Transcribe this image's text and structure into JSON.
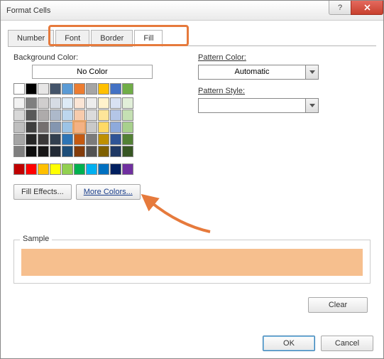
{
  "window": {
    "title": "Format Cells"
  },
  "tabs": {
    "items": [
      "Number",
      "Font",
      "Border",
      "Fill"
    ],
    "active": 3
  },
  "left": {
    "bg_label": "Background Color:",
    "no_color": "No Color",
    "fill_effects": "Fill Effects...",
    "more_colors": "More Colors...",
    "palette_theme": [
      [
        "#ffffff",
        "#000000",
        "#e7e6e6",
        "#44546a",
        "#5b9bd5",
        "#ed7d31",
        "#a5a5a5",
        "#ffc000",
        "#4472c4",
        "#70ad47"
      ],
      [
        "#f2f2f2",
        "#7f7f7f",
        "#d0cece",
        "#d6dce4",
        "#deebf6",
        "#fbe5d5",
        "#ededed",
        "#fff2cc",
        "#d9e2f3",
        "#e2efd9"
      ],
      [
        "#d8d8d8",
        "#595959",
        "#aeabab",
        "#adb9ca",
        "#bdd7ee",
        "#f7cbac",
        "#dbdbdb",
        "#fee599",
        "#b4c6e7",
        "#c5e0b3"
      ],
      [
        "#bfbfbf",
        "#3f3f3f",
        "#757070",
        "#8496b0",
        "#9cc3e5",
        "#f4b183",
        "#c9c9c9",
        "#ffd965",
        "#8eaadb",
        "#a8d08d"
      ],
      [
        "#a5a5a5",
        "#262626",
        "#3a3838",
        "#323f4f",
        "#2e75b5",
        "#c55a11",
        "#7b7b7b",
        "#bf9000",
        "#2f5496",
        "#538135"
      ],
      [
        "#7f7f7f",
        "#0c0c0c",
        "#171616",
        "#222a35",
        "#1e4e79",
        "#833c0b",
        "#525252",
        "#7f6000",
        "#1f3864",
        "#375623"
      ]
    ],
    "palette_standard": [
      "#c00000",
      "#ff0000",
      "#ffc000",
      "#ffff00",
      "#92d050",
      "#00b050",
      "#00b0f0",
      "#0070c0",
      "#002060",
      "#7030a0"
    ],
    "selected_color": "#f4b183"
  },
  "right": {
    "pattern_color_label": "Pattern Color:",
    "pattern_color_value": "Automatic",
    "pattern_style_label": "Pattern Style:",
    "pattern_style_value": ""
  },
  "sample": {
    "label": "Sample",
    "color": "#f6bf8e"
  },
  "buttons": {
    "clear": "Clear",
    "ok": "OK",
    "cancel": "Cancel"
  },
  "icons": {
    "help": "help-icon",
    "close": "close-icon",
    "dropdown": "chevron-down-icon"
  }
}
